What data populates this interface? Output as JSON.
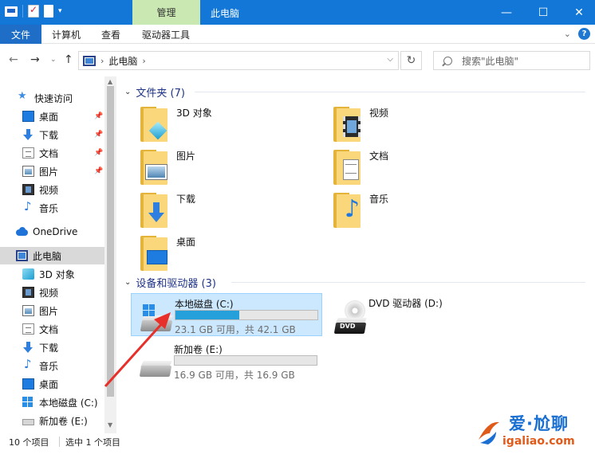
{
  "window": {
    "title": "此电脑",
    "context_tab": "管理",
    "min_glyph": "—",
    "max_glyph": "☐",
    "close_glyph": "✕"
  },
  "ribbon": {
    "tabs": [
      "文件",
      "计算机",
      "查看",
      "驱动器工具"
    ],
    "help_glyph": "?"
  },
  "address": {
    "path": "此电脑",
    "search_placeholder": "搜索\"此电脑\""
  },
  "nav_pane": {
    "items": [
      {
        "label": "快速访问",
        "icon": "star-icon"
      },
      {
        "label": "桌面",
        "icon": "desktop-icon",
        "pinned": true
      },
      {
        "label": "下载",
        "icon": "download-icon",
        "pinned": true
      },
      {
        "label": "文档",
        "icon": "document-icon",
        "pinned": true
      },
      {
        "label": "图片",
        "icon": "picture-icon",
        "pinned": true
      },
      {
        "label": "视频",
        "icon": "video-icon"
      },
      {
        "label": "音乐",
        "icon": "music-icon"
      },
      {
        "label": "OneDrive",
        "icon": "cloud-icon"
      },
      {
        "label": "此电脑",
        "icon": "computer-icon",
        "selected": true
      },
      {
        "label": "3D 对象",
        "icon": "3d-objects-icon"
      },
      {
        "label": "视频",
        "icon": "video-icon"
      },
      {
        "label": "图片",
        "icon": "picture-icon"
      },
      {
        "label": "文档",
        "icon": "document-icon"
      },
      {
        "label": "下载",
        "icon": "download-icon"
      },
      {
        "label": "音乐",
        "icon": "music-icon"
      },
      {
        "label": "桌面",
        "icon": "desktop-icon"
      },
      {
        "label": "本地磁盘 (C:)",
        "icon": "windows-drive-icon"
      },
      {
        "label": "新加卷 (E:)",
        "icon": "drive-icon"
      }
    ]
  },
  "content": {
    "folders_header": "文件夹 (7)",
    "folders": [
      {
        "name": "3D 对象",
        "icon": "3d-objects-folder-icon"
      },
      {
        "name": "视频",
        "icon": "videos-folder-icon"
      },
      {
        "name": "图片",
        "icon": "pictures-folder-icon"
      },
      {
        "name": "文档",
        "icon": "documents-folder-icon"
      },
      {
        "name": "下载",
        "icon": "downloads-folder-icon"
      },
      {
        "name": "音乐",
        "icon": "music-folder-icon"
      },
      {
        "name": "桌面",
        "icon": "desktop-folder-icon"
      }
    ],
    "devices_header": "设备和驱动器 (3)",
    "drives": [
      {
        "name": "本地磁盘 (C:)",
        "free_text": "23.1 GB 可用，共 42.1 GB",
        "used_fraction": 0.45,
        "selected": true
      },
      {
        "name": "DVD 驱动器 (D:)",
        "dvd_label": "DVD"
      },
      {
        "name": "新加卷 (E:)",
        "free_text": "16.9 GB 可用，共 16.9 GB",
        "used_fraction": 0.0
      }
    ]
  },
  "status": {
    "count": "10 个项目",
    "selection": "选中 1 个项目"
  },
  "watermark": {
    "line1": "爱·尬聊",
    "line2": "igaliao.com"
  },
  "colors": {
    "titlebar": "#1277d6",
    "accent": "#26a0da",
    "selection": "#cce8ff",
    "annotation_arrow": "#e8302a"
  }
}
